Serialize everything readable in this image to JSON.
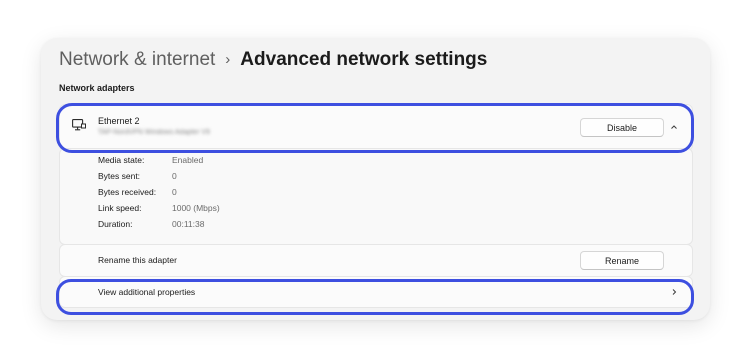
{
  "breadcrumb": {
    "parent": "Network & internet",
    "separator": "›",
    "current": "Advanced network settings"
  },
  "section_title": "Network adapters",
  "adapter": {
    "name": "Ethernet 2",
    "description": "TAP-NordVPN Windows Adapter V9",
    "icon": "ethernet-monitor-icon",
    "disable_label": "Disable",
    "expanded_icon": "chevron-up-icon"
  },
  "details": [
    {
      "label": "Media state:",
      "value": "Enabled"
    },
    {
      "label": "Bytes sent:",
      "value": "0"
    },
    {
      "label": "Bytes received:",
      "value": "0"
    },
    {
      "label": "Link speed:",
      "value": "1000 (Mbps)"
    },
    {
      "label": "Duration:",
      "value": "00:11:38"
    }
  ],
  "rename": {
    "label": "Rename this adapter",
    "button_label": "Rename"
  },
  "properties": {
    "label": "View additional properties",
    "icon": "chevron-right-icon"
  },
  "colors": {
    "highlight": "#3d4fe0",
    "window_bg": "#f3f3f3"
  }
}
